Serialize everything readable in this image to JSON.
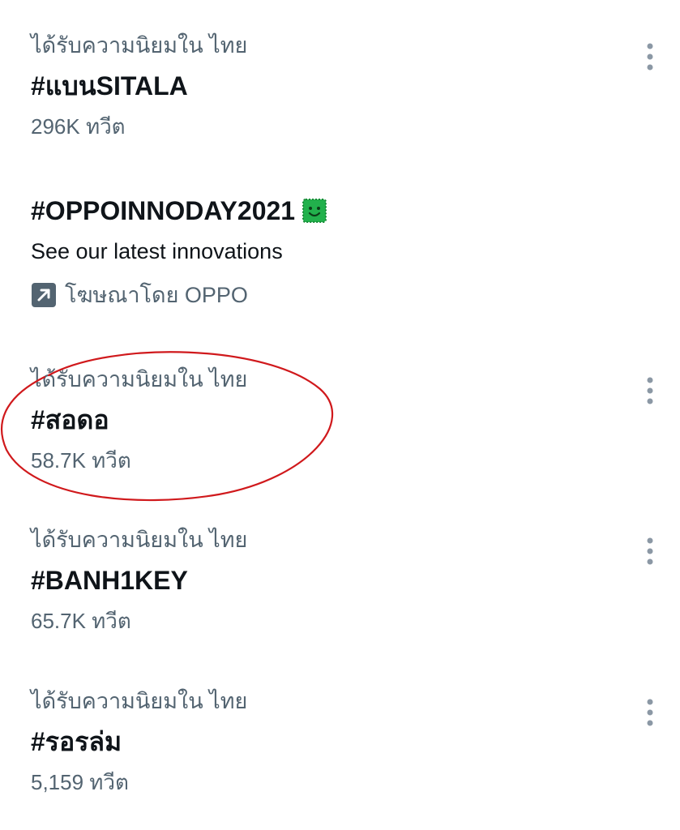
{
  "trends": [
    {
      "context": "ได้รับความนิยมใน ไทย",
      "title": "#แบนSITALA",
      "count": "296K ทวีต",
      "icon": "more-vertical-icon"
    },
    {
      "context": "ได้รับความนิยมใน ไทย",
      "title": "#สอดอ",
      "count": "58.7K ทวีต",
      "icon": "more-vertical-icon"
    },
    {
      "context": "ได้รับความนิยมใน ไทย",
      "title": "#BANH1KEY",
      "count": "65.7K ทวีต",
      "icon": "more-vertical-icon"
    },
    {
      "context": "ได้รับความนิยมใน ไทย",
      "title": "#รอรล่ม",
      "count": "5,159 ทวีต",
      "icon": "more-vertical-icon"
    }
  ],
  "promoted": {
    "title": "#OPPOINNODAY2021",
    "emoji_icon": "smiley-badge-icon",
    "emoji_color": "#22b14c",
    "description": "See our latest innovations",
    "promoted_by": "โฆษณาโดย OPPO",
    "promoted_icon": "promoted-arrow-icon"
  },
  "colors": {
    "primary_text": "#0f1419",
    "secondary_text": "#536471",
    "annotation": "#d0191c",
    "icon_gray": "#536471"
  }
}
